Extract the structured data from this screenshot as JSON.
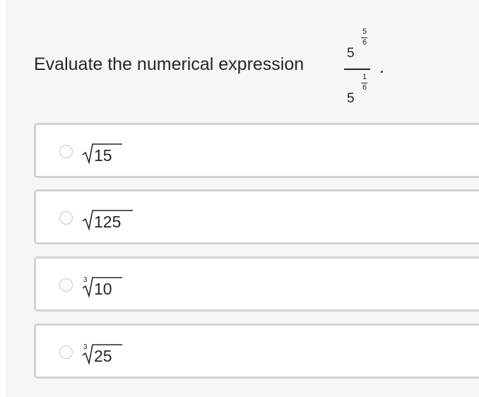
{
  "question": {
    "prompt": "Evaluate the numerical expression",
    "numerator_base": "5",
    "numerator_exp_num": "5",
    "numerator_exp_den": "6",
    "denominator_base": "5",
    "denominator_exp_num": "1",
    "denominator_exp_den": "6",
    "period": "."
  },
  "options": [
    {
      "index": "",
      "radicand": "15"
    },
    {
      "index": "",
      "radicand": "125"
    },
    {
      "index": "3",
      "radicand": "10"
    },
    {
      "index": "3",
      "radicand": "25"
    }
  ]
}
